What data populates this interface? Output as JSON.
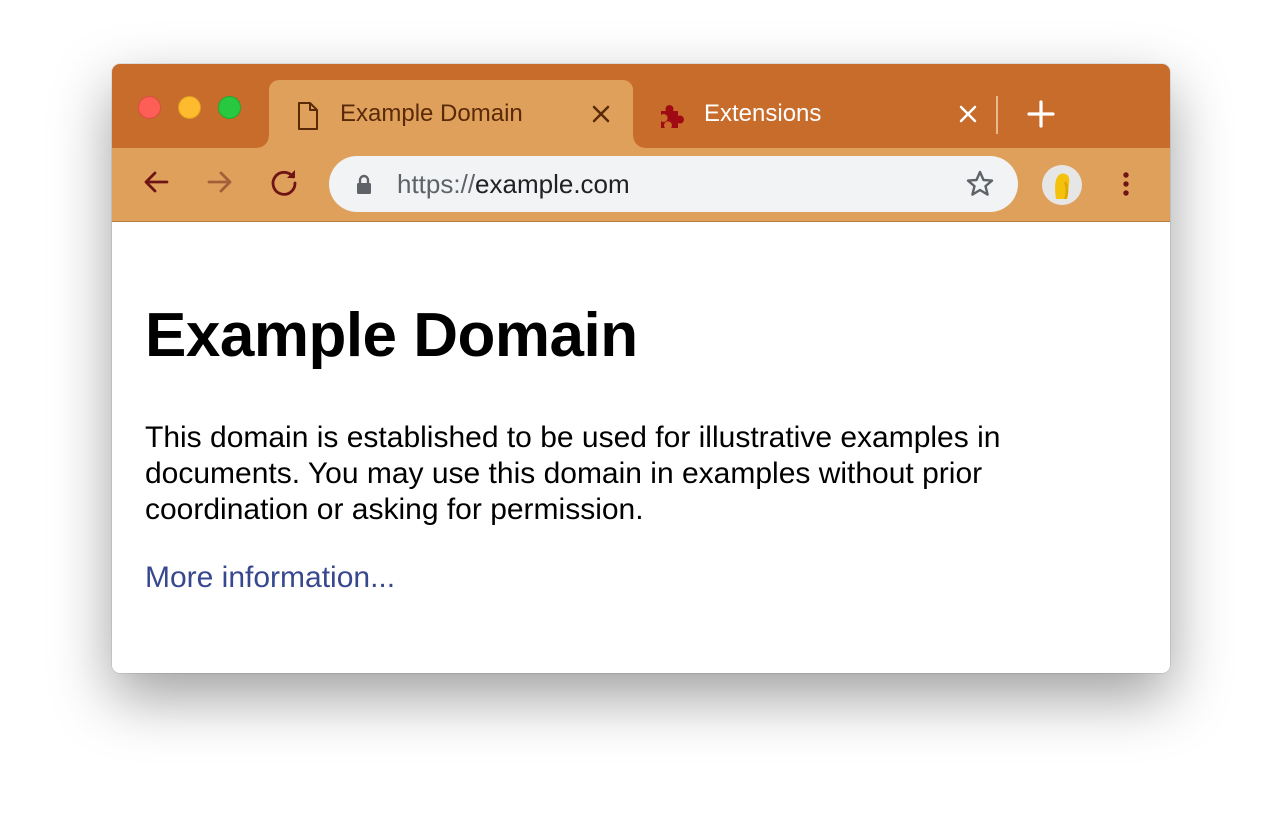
{
  "colors": {
    "tabstrip": "#c76c2b",
    "active_tab": "#dfa05b",
    "toolbar": "#dfa05b",
    "omnibox": "#f1f3f4",
    "link": "#38488f"
  },
  "tabs": [
    {
      "title": "Example Domain",
      "icon": "page-icon",
      "active": true
    },
    {
      "title": "Extensions",
      "icon": "puzzle-icon",
      "active": false
    }
  ],
  "omnibox": {
    "scheme": "https://",
    "host": "example.com"
  },
  "page": {
    "heading": "Example Domain",
    "body": "This domain is established to be used for illustrative examples in documents. You may use this domain in examples without prior coordination or asking for permission.",
    "link_text": "More information..."
  }
}
